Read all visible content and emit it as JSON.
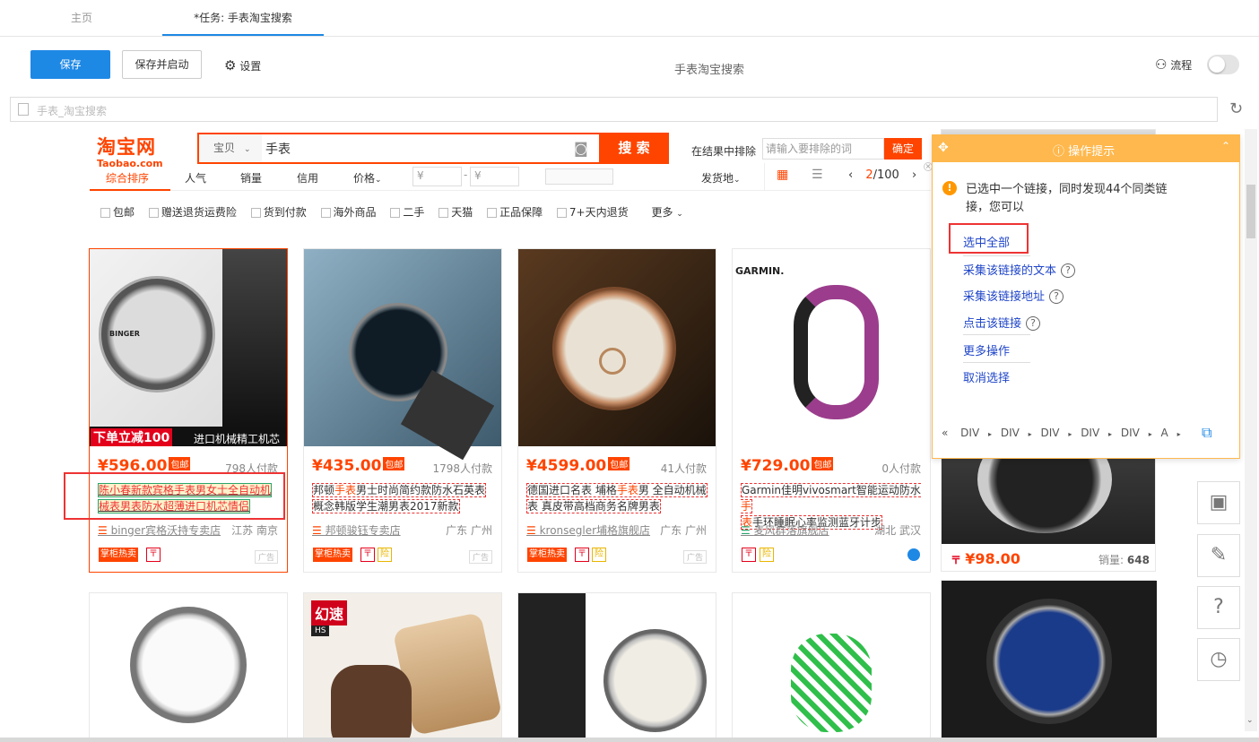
{
  "tabs": {
    "home": "主页",
    "task": "*任务: 手表淘宝搜索"
  },
  "toolbar": {
    "save": "保存",
    "save_start": "保存并启动",
    "settings": "设置",
    "title": "手表淘宝搜索",
    "flow": "流程"
  },
  "address": {
    "url": "手表_淘宝搜索"
  },
  "taobao": {
    "logo_cn": "淘宝网",
    "logo_en": "Taobao.com",
    "scope": "宝贝",
    "query": "手表",
    "search_btn": "搜 索",
    "exclude_label": "在结果中排除",
    "exclude_placeholder": "请输入要排除的词",
    "confirm": "确定"
  },
  "sort": {
    "items": [
      "综合排序",
      "人气",
      "销量",
      "信用",
      "价格"
    ],
    "price_from": "¥",
    "price_to": "¥",
    "dash": "-",
    "ship": "发货地",
    "page_cur": "2",
    "page_total": "/100"
  },
  "filters": [
    "包邮",
    "赠送退货运费险",
    "货到付款",
    "海外商品",
    "二手",
    "天猫",
    "正品保障",
    "7+天内退货"
  ],
  "filters_more": "更多",
  "products": [
    {
      "price": "¥596.00",
      "free": "包邮",
      "buyers": "798人付款",
      "title_a": "陈小春新款宾格手表男女士全自动机",
      "title_b": "械表男表防水超薄进口机芯情侣",
      "shop": "binger宾格沃持专卖店",
      "loc": "江苏 南京",
      "badge": "掌柜热卖",
      "ad": "广告",
      "banner_a": "下单立减100",
      "banner_b": "进口机械精工机芯",
      "brand": "BINGER"
    },
    {
      "price": "¥435.00",
      "free": "包邮",
      "buyers": "1798人付款",
      "title_a": "邦顿",
      "title_hl": "手表",
      "title_b": "男士时尚简约款防水石英表",
      "title_c": "概念韩版学生潮男表2017新款",
      "shop": "邦顿骏钰专卖店",
      "loc": "广东 广州",
      "badge": "掌柜热卖",
      "ad": "广告"
    },
    {
      "price": "¥4599.00",
      "free": "包邮",
      "buyers": "41人付款",
      "title_a": "德国进口名表 埔格",
      "title_hl": "手表",
      "title_b": "男 全自动机械",
      "title_c": "表 真皮带高档商务名牌男表",
      "shop": "kronsegler埔格旗舰店",
      "loc": "广东 广州",
      "badge": "掌柜热卖",
      "ad": "广告"
    },
    {
      "price": "¥729.00",
      "free": "包邮",
      "buyers": "0人付款",
      "title_a": "Garmin佳明vivosmart智能运动防水",
      "title_hl": "手",
      "title_b": "表",
      "title_c": "手环睡眠心率监测蓝牙计步",
      "shop": "麦风群落旗舰店",
      "loc": "湖北 武汉",
      "brand": "GARMIN."
    }
  ],
  "row2": {
    "p2_banner": "幻速",
    "p2_sub": "HS"
  },
  "right_card": {
    "price": "¥98.00",
    "sales_label": "销量:",
    "sales": "648"
  },
  "tip": {
    "title": "操作提示",
    "message_a": "已选中一个链接，同时发现44个同类链",
    "message_b": "接，您可以",
    "select_all": "选中全部",
    "collect_text": "采集该链接的文本",
    "collect_url": "采集该链接地址",
    "click_link": "点击该链接",
    "more_ops": "更多操作",
    "cancel": "取消选择",
    "path": [
      "DIV",
      "DIV",
      "DIV",
      "DIV",
      "DIV",
      "A"
    ]
  },
  "colors": {
    "accent": "#1e88e5",
    "taobao": "#ff4400",
    "tip_header": "#ffb84d",
    "highlight": "#e33"
  }
}
